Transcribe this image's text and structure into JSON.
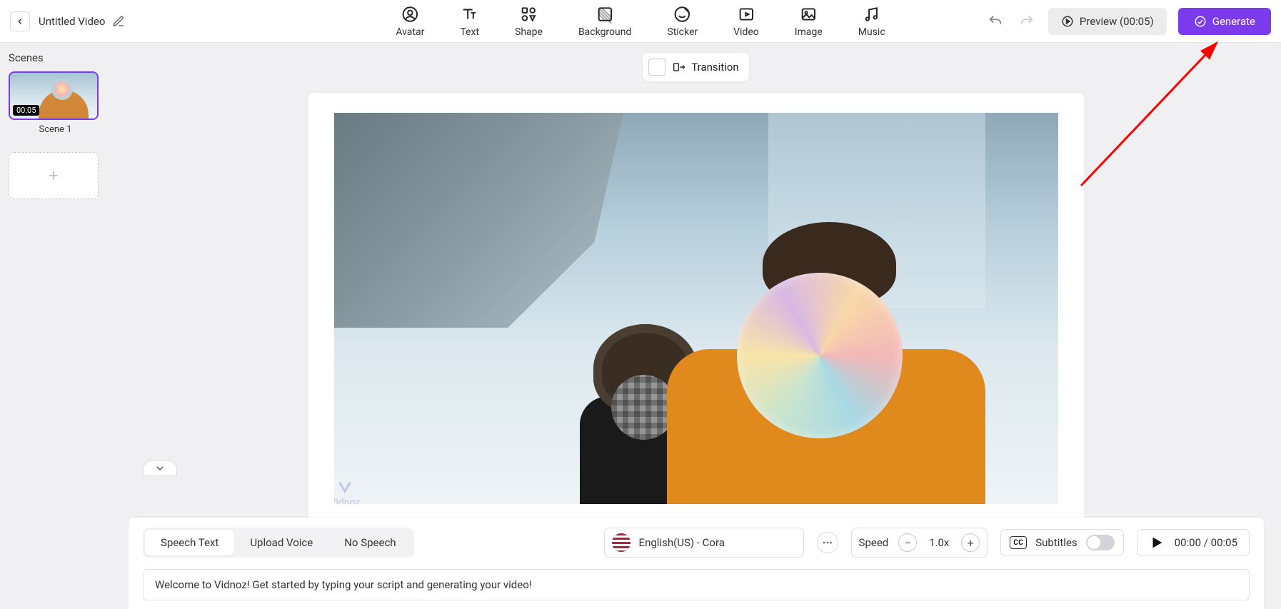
{
  "header": {
    "title": "Untitled Video",
    "preview_label": "Preview (00:05)",
    "generate_label": "Generate",
    "tools": [
      {
        "id": "avatar",
        "label": "Avatar"
      },
      {
        "id": "text",
        "label": "Text"
      },
      {
        "id": "shape",
        "label": "Shape"
      },
      {
        "id": "background",
        "label": "Background"
      },
      {
        "id": "sticker",
        "label": "Sticker"
      },
      {
        "id": "video",
        "label": "Video"
      },
      {
        "id": "image",
        "label": "Image"
      },
      {
        "id": "music",
        "label": "Music"
      }
    ]
  },
  "transition_label": "Transition",
  "sidebar": {
    "title": "Scenes",
    "scenes": [
      {
        "name": "Scene 1",
        "duration": "00:05"
      }
    ]
  },
  "watermark": "Vidnoz",
  "bottom": {
    "tabs": {
      "speech": "Speech Text",
      "upload": "Upload Voice",
      "none": "No Speech",
      "active": "speech"
    },
    "voice": "English(US) - Cora",
    "speed_label": "Speed",
    "speed_value": "1.0x",
    "subtitles_label": "Subtitles",
    "cc": "CC",
    "time": "00:00 / 00:05",
    "script": "Welcome to Vidnoz! Get started by typing your script and generating your video!"
  }
}
